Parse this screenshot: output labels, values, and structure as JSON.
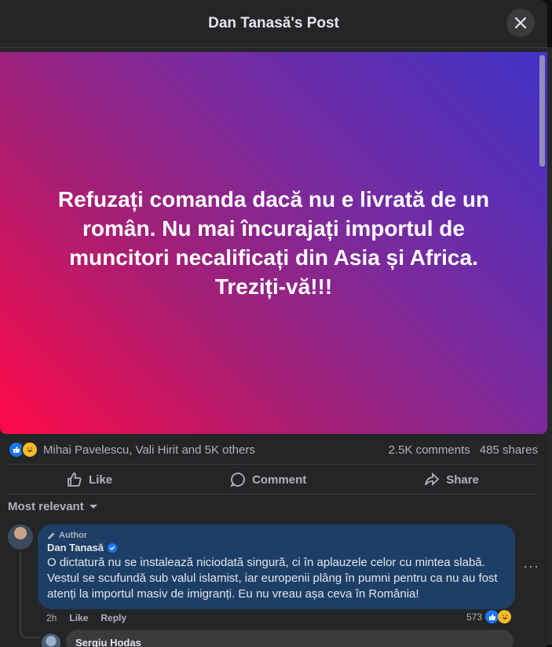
{
  "header": {
    "title": "Dan Tanasă's Post"
  },
  "post": {
    "text": "Refuzați comanda dacă nu e livrată de un român. Nu mai încurajați importul de muncitori necalificați din Asia și Africa. Treziți-vă!!!",
    "gradient_colors": [
      "#3f33c6",
      "#7b2a9c",
      "#a51f74",
      "#ff0a48"
    ]
  },
  "stats": {
    "reactions_text": "Mihai Pavelescu, Vali Hirit and 5K others",
    "comments": "2.5K comments",
    "shares": "485 shares"
  },
  "actions": {
    "like": "Like",
    "comment": "Comment",
    "share": "Share"
  },
  "sort": {
    "label": "Most relevant"
  },
  "comment": {
    "badge": "Author",
    "name": "Dan Tanasă",
    "text": "O dictatură nu se instalează niciodată singură, ci în aplauzele celor cu mintea slabă. Vestul se scufundă sub valul islamist, iar europenii plâng în pumni pentru ca nu au fost atenți la importul masiv de imigranți. Eu nu vreau așa ceva în România!",
    "time": "2h",
    "like": "Like",
    "reply": "Reply",
    "reaction_count": "573"
  },
  "reply": {
    "name": "Sergiu Hodas"
  },
  "colors": {
    "accent": "#1877f2",
    "bubble": "#1d3e66",
    "surface": "#242526"
  }
}
